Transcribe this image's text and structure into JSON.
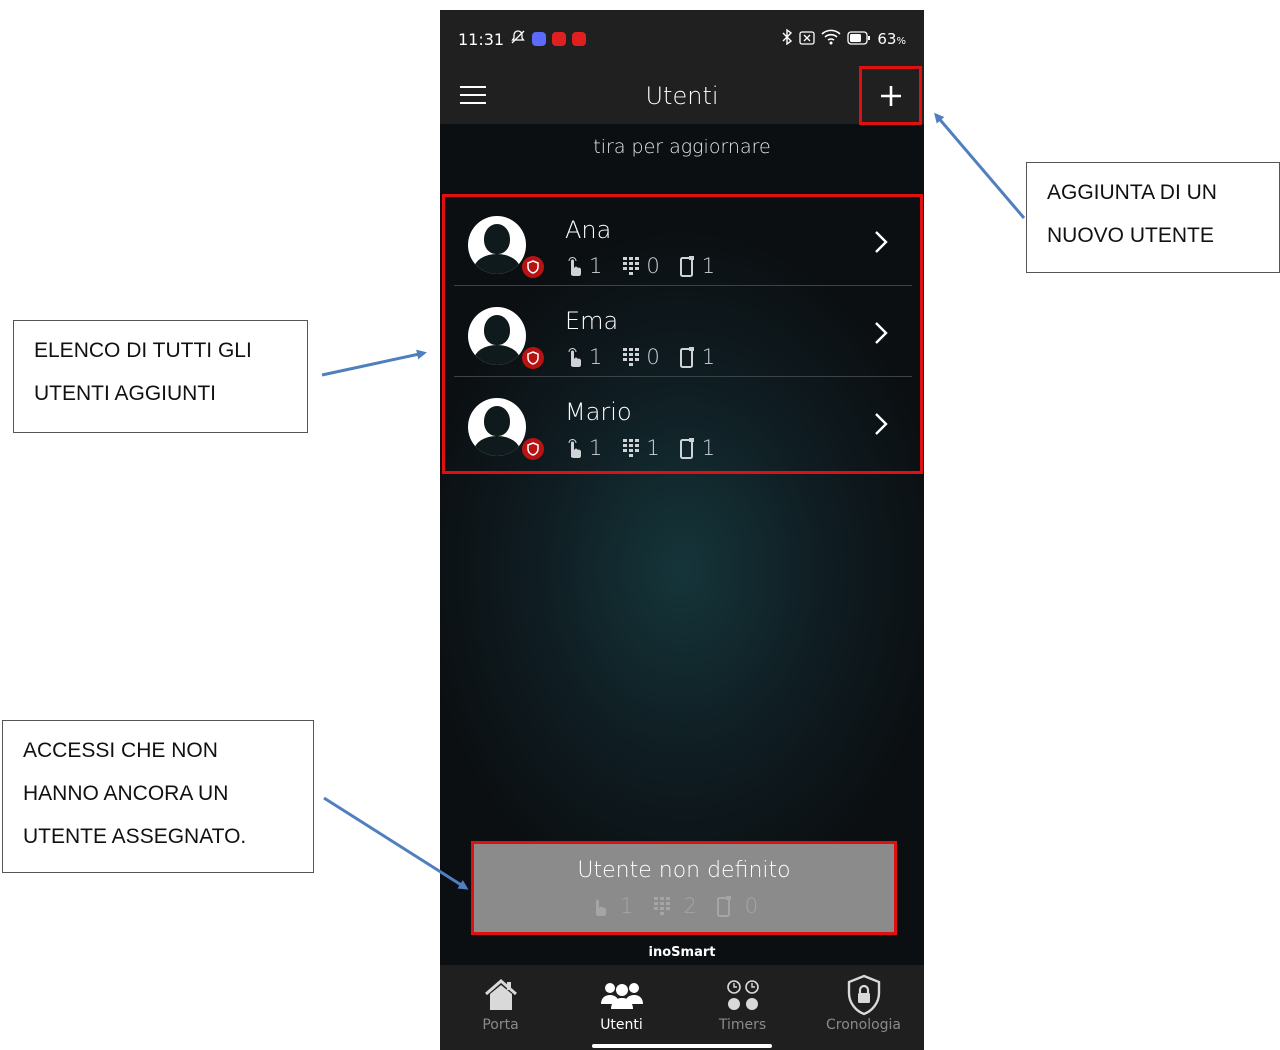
{
  "status_bar": {
    "time": "11:31",
    "battery": "63",
    "battery_unit": "%",
    "icons": [
      "mute-icon",
      "app-icon",
      "youtube-icon",
      "youtube-icon",
      "bluetooth-icon",
      "sim-icon",
      "wifi-icon",
      "battery-icon"
    ]
  },
  "header": {
    "title": "Utenti",
    "menu_icon": "hamburger-icon",
    "add_icon": "plus-icon"
  },
  "pull_hint": "tira per aggiornare",
  "users": [
    {
      "name": "Ana",
      "fingerprints": "1",
      "codes": "0",
      "phones": "1"
    },
    {
      "name": "Ema",
      "fingerprints": "1",
      "codes": "0",
      "phones": "1"
    },
    {
      "name": "Mario",
      "fingerprints": "1",
      "codes": "1",
      "phones": "1"
    }
  ],
  "undefined_user": {
    "title": "Utente non definito",
    "fingerprints": "1",
    "codes": "2",
    "phones": "0"
  },
  "brand": "inoSmart",
  "nav": [
    {
      "label": "Porta",
      "icon": "home-icon",
      "active": false
    },
    {
      "label": "Utenti",
      "icon": "users-icon",
      "active": true
    },
    {
      "label": "Timers",
      "icon": "timers-icon",
      "active": false
    },
    {
      "label": "Cronologia",
      "icon": "shield-lock-icon",
      "active": false
    }
  ],
  "annotations": {
    "add_user": [
      "AGGIUNTA DI UN",
      "NUOVO UTENTE"
    ],
    "user_list": [
      "ELENCO DI TUTTI GLI",
      "UTENTI AGGIUNTI"
    ],
    "unassigned": [
      "ACCESSI CHE NON",
      "HANNO ANCORA UN",
      "UTENTE ASSEGNATO."
    ]
  },
  "colors": {
    "highlight": "#e01010",
    "arrow": "#4f7fbf",
    "bar_bg": "#202020",
    "badge": "#b81313",
    "undefined_bg": "#8b8b8b"
  }
}
